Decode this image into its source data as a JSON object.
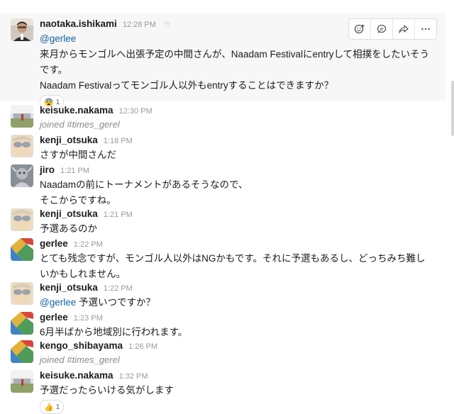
{
  "colors": {
    "mention": "#1264a3",
    "highlight": "#f7f7f7"
  },
  "action_bar": {
    "icons": [
      "add-reaction-icon",
      "reply-thread-icon",
      "share-message-icon",
      "more-actions-icon"
    ]
  },
  "messages": [
    {
      "author": "naotaka.ishikami",
      "time": "12:28 PM",
      "mention": "@gerlee",
      "lines": [
        "来月からモンゴルへ出張予定の中間さんが、Naadam Festivalにentryして相撲をしたいそう",
        "です。",
        "Naadam Festivalってモンゴル人以外もentryすることはできますか？"
      ],
      "reaction": {
        "emoji": "😨",
        "count": "1"
      }
    },
    {
      "author": "keisuke.nakama",
      "time": "12:30 PM",
      "system": "joined #times_gerel"
    },
    {
      "author": "kenji_otsuka",
      "time": "1:18 PM",
      "lines": [
        "さすが中間さんだ"
      ]
    },
    {
      "author": "jiro",
      "time": "1:21 PM",
      "lines": [
        "Naadamの前にトーナメントがあるそうなので、",
        "そこからですね。"
      ]
    },
    {
      "author": "kenji_otsuka",
      "time": "1:21 PM",
      "lines": [
        "予選あるのか"
      ]
    },
    {
      "author": "gerlee",
      "time": "1:22 PM",
      "lines": [
        "とても残念ですが、モンゴル人以外はNGかもです。それに予選もあるし、どっちみち難し",
        "いかもしれません。"
      ]
    },
    {
      "author": "kenji_otsuka",
      "time": "1:22 PM",
      "mention": "@gerlee",
      "inline_text": " 予選いつですか？"
    },
    {
      "author": "gerlee",
      "time": "1:23 PM",
      "lines": [
        "6月半ばから地域別に行われます。"
      ]
    },
    {
      "author": "kengo_shibayama",
      "time": "1:26 PM",
      "system": "joined #times_gerel"
    },
    {
      "author": "keisuke.nakama",
      "time": "1:32 PM",
      "lines": [
        "予選だったらいける気がします"
      ],
      "reaction": {
        "emoji": "👍",
        "count": "1"
      }
    }
  ]
}
